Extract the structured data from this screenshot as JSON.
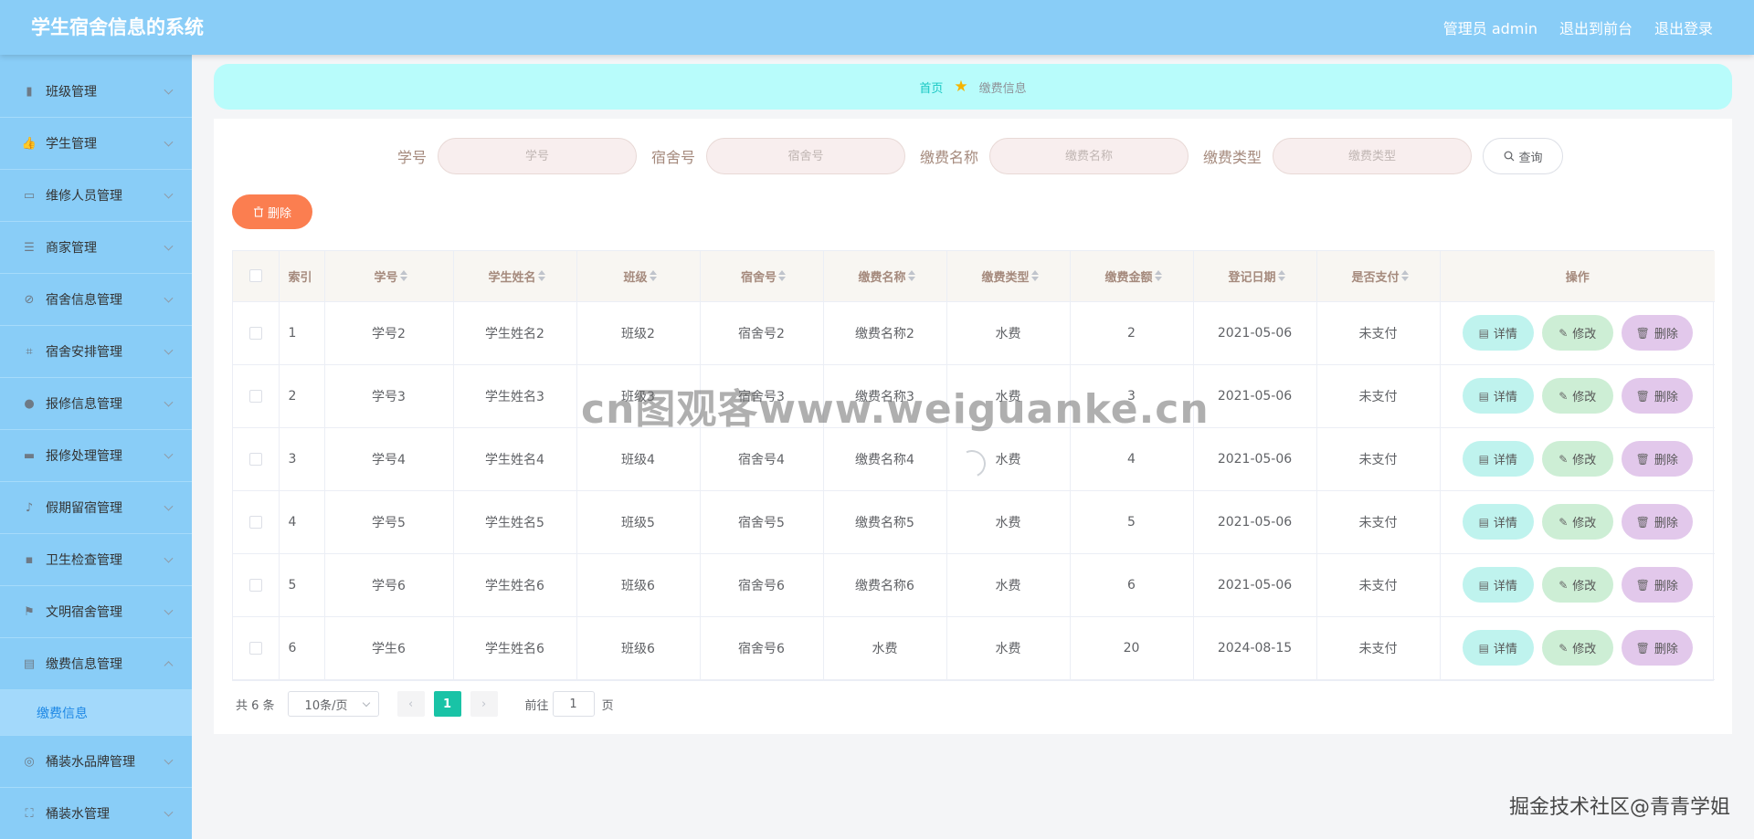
{
  "header": {
    "title": "学生宿舍信息的系统",
    "user": "管理员 admin",
    "frontend_link": "退出到前台",
    "logout_link": "退出登录"
  },
  "sidebar": {
    "items": [
      {
        "label": "班级管理",
        "icon": "bar-chart-icon"
      },
      {
        "label": "学生管理",
        "icon": "thumbs-up-icon"
      },
      {
        "label": "维修人员管理",
        "icon": "id-card-icon"
      },
      {
        "label": "商家管理",
        "icon": "sliders-icon"
      },
      {
        "label": "宿舍信息管理",
        "icon": "no-entry-icon"
      },
      {
        "label": "宿舍安排管理",
        "icon": "crop-icon"
      },
      {
        "label": "报修信息管理",
        "icon": "location-pin-icon"
      },
      {
        "label": "报修处理管理",
        "icon": "briefcase-icon"
      },
      {
        "label": "假期留宿管理",
        "icon": "microphone-icon"
      },
      {
        "label": "卫生检查管理",
        "icon": "chat-icon"
      },
      {
        "label": "文明宿舍管理",
        "icon": "flag-icon"
      },
      {
        "label": "缴费信息管理",
        "icon": "notebook-icon"
      },
      {
        "label": "桶装水品牌管理",
        "icon": "compass-icon"
      },
      {
        "label": "桶装水管理",
        "icon": "fullscreen-icon"
      }
    ],
    "sub_item": "缴费信息"
  },
  "breadcrumb": {
    "home": "首页",
    "current": "缴费信息"
  },
  "search": {
    "fields": [
      {
        "label": "学号",
        "placeholder": "学号"
      },
      {
        "label": "宿舍号",
        "placeholder": "宿舍号"
      },
      {
        "label": "缴费名称",
        "placeholder": "缴费名称"
      },
      {
        "label": "缴费类型",
        "placeholder": "缴费类型"
      }
    ],
    "query_label": "查询"
  },
  "toolbar": {
    "delete_label": "删除"
  },
  "table": {
    "headers": [
      "索引",
      "学号",
      "学生姓名",
      "班级",
      "宿舍号",
      "缴费名称",
      "缴费类型",
      "缴费金额",
      "登记日期",
      "是否支付",
      "操作"
    ],
    "rows": [
      [
        "1",
        "学号2",
        "学生姓名2",
        "班级2",
        "宿舍号2",
        "缴费名称2",
        "水费",
        "2",
        "2021-05-06",
        "未支付"
      ],
      [
        "2",
        "学号3",
        "学生姓名3",
        "班级3",
        "宿舍号3",
        "缴费名称3",
        "水费",
        "3",
        "2021-05-06",
        "未支付"
      ],
      [
        "3",
        "学号4",
        "学生姓名4",
        "班级4",
        "宿舍号4",
        "缴费名称4",
        "水费",
        "4",
        "2021-05-06",
        "未支付"
      ],
      [
        "4",
        "学号5",
        "学生姓名5",
        "班级5",
        "宿舍号5",
        "缴费名称5",
        "水费",
        "5",
        "2021-05-06",
        "未支付"
      ],
      [
        "5",
        "学号6",
        "学生姓名6",
        "班级6",
        "宿舍号6",
        "缴费名称6",
        "水费",
        "6",
        "2021-05-06",
        "未支付"
      ],
      [
        "6",
        "学生6",
        "学生姓名6",
        "班级6",
        "宿舍号6",
        "水费",
        "水费",
        "20",
        "2024-08-15",
        "未支付"
      ]
    ],
    "actions": {
      "detail": "详情",
      "edit": "修改",
      "delete": "删除"
    }
  },
  "pagination": {
    "total": "共 6 条",
    "page_size": "10条/页",
    "current_page": "1",
    "goto_prefix": "前往",
    "goto_value": "1",
    "goto_suffix": "页"
  },
  "overlays": {
    "watermark": "cn图观客www.weiguanke.cn",
    "credit": "掘金技术社区@青青学姐"
  },
  "colors": {
    "header_bg": "#89cdf7",
    "breadcrumb_bg": "#b8fcfb",
    "delete_btn": "#fb7e50",
    "active_page": "#19c3a6",
    "detail_btn": "#bff3ee",
    "edit_btn": "#cdeed5",
    "row_delete_btn": "#e2c8eb"
  }
}
